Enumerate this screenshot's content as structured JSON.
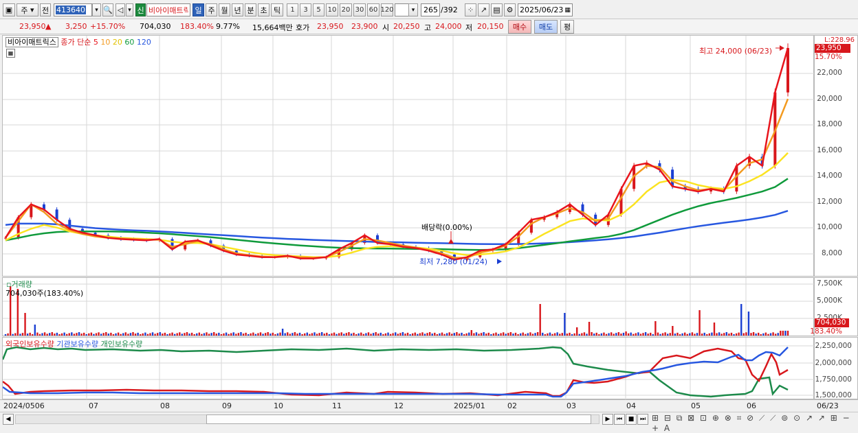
{
  "toolbar": {
    "market_type": "주",
    "prev_label": "전",
    "code": "413640",
    "name_badge": "신",
    "stock_name": "비아이매트릭스",
    "periods": [
      "일",
      "주",
      "월",
      "년",
      "분",
      "초",
      "틱"
    ],
    "numbers": [
      "1",
      "3",
      "5",
      "10",
      "20",
      "30",
      "60",
      "120"
    ],
    "count": "265",
    "count_total": "/392",
    "date": "2025/06/23"
  },
  "info": {
    "price": "23,950",
    "change_sym": "▲",
    "change": "3,250",
    "change_pct": "+15.70%",
    "volume": "704,030",
    "volume_pct": "183.40%",
    "turnover_ratio": "9.77%",
    "amount": "15,664백만",
    "ask_label": "호가",
    "ask": "23,950",
    "bid": "23,900",
    "open_label": "시",
    "open": "20,250",
    "high_label": "고",
    "high": "24,000",
    "low_label": "저",
    "low": "20,150",
    "buy_button": "매수",
    "sell_button": "매도",
    "eval_button": "평"
  },
  "price_panel": {
    "legend_name": "비아이매트릭스",
    "legend_title": "종가 단순",
    "ma_periods": [
      "5",
      "10",
      "20",
      "60",
      "120"
    ],
    "ma_colors": [
      "#e8141c",
      "#f39a1f",
      "#fbe321",
      "#0f9a3b",
      "#2757e0"
    ],
    "max_label": "최고 24,000 (06/23)",
    "min_label": "최저 7,280 (01/24)",
    "dividend_label": "배당락(0.00%)",
    "axis_top": "L:228.96",
    "axis_price": "23,950",
    "axis_pct": "15.70%",
    "yticks": [
      "22,000",
      "20,000",
      "18,000",
      "16,000",
      "14,000",
      "12,000",
      "10,000",
      "8,000"
    ]
  },
  "volume_panel": {
    "title": "거래량",
    "value_label": "704,030주(183.40%)",
    "yticks": [
      "7,500K",
      "5,000K",
      "2,500K"
    ],
    "axis_value": "704,030",
    "axis_pct": "183.40%"
  },
  "holdings_panel": {
    "legend": [
      "외국인보유수량",
      "기관보유수량",
      "개인보유수량"
    ],
    "yticks": [
      "2,250,000",
      "2,000,000",
      "1,750,000",
      "1,500,000"
    ]
  },
  "dates": [
    "2024/0506",
    "07",
    "08",
    "09",
    "10",
    "11",
    "12",
    "2025/01",
    "02",
    "03",
    "04",
    "05",
    "06",
    "06/23"
  ],
  "chart_data": {
    "type": "candlestick",
    "price": {
      "ylim": [
        7000,
        24300
      ],
      "max": {
        "value": 24000,
        "date": "06/23"
      },
      "min": {
        "value": 7280,
        "date": "01/24"
      },
      "last": 23950,
      "close": [
        9200,
        10800,
        11800,
        11400,
        10600,
        9900,
        9600,
        9400,
        9200,
        9100,
        9050,
        9000,
        9100,
        8300,
        8900,
        9000,
        8600,
        8200,
        7900,
        7800,
        7700,
        7700,
        7800,
        7600,
        7600,
        7700,
        8300,
        8800,
        9400,
        8800,
        8700,
        8500,
        8400,
        8200,
        7900,
        7500,
        7700,
        8200,
        8300,
        8700,
        9600,
        10600,
        10800,
        11200,
        11800,
        11000,
        10200,
        11000,
        13000,
        14800,
        15000,
        14500,
        13200,
        13000,
        12800,
        13000,
        12800,
        14800,
        15500,
        14800,
        20500,
        23950
      ],
      "ma5": [
        9200,
        10500,
        11800,
        11200,
        10300,
        9800,
        9500,
        9300,
        9200,
        9150,
        9100,
        9050,
        9050,
        8500,
        8700,
        8950,
        8700,
        8300,
        8000,
        7850,
        7750,
        7700,
        7750,
        7700,
        7650,
        7700,
        8100,
        8600,
        9100,
        9000,
        8800,
        8600,
        8450,
        8250,
        8000,
        7650,
        7650,
        8050,
        8250,
        8600,
        9300,
        10300,
        10800,
        11100,
        11500,
        11200,
        10500,
        10700,
        12300,
        14000,
        14800,
        14700,
        13600,
        13200,
        12900,
        13000,
        12900,
        14000,
        15000,
        15300,
        17500,
        20000
      ],
      "ma20": [
        9000,
        9500,
        9900,
        10200,
        10000,
        9700,
        9500,
        9400,
        9300,
        9200,
        9150,
        9100,
        9050,
        8900,
        8800,
        8800,
        8700,
        8500,
        8300,
        8100,
        7950,
        7850,
        7800,
        7750,
        7700,
        7700,
        7800,
        8050,
        8350,
        8500,
        8550,
        8500,
        8450,
        8350,
        8200,
        8000,
        7850,
        7900,
        8000,
        8150,
        8450,
        8950,
        9500,
        10000,
        10500,
        10700,
        10600,
        10550,
        11000,
        11800,
        12800,
        13500,
        13700,
        13600,
        13300,
        13100,
        13000,
        13200,
        13600,
        14100,
        14800,
        15800
      ],
      "ma60": [
        9000,
        9200,
        9400,
        9550,
        9650,
        9700,
        9700,
        9700,
        9700,
        9680,
        9650,
        9600,
        9550,
        9480,
        9400,
        9330,
        9250,
        9150,
        9050,
        8950,
        8850,
        8760,
        8680,
        8600,
        8540,
        8480,
        8430,
        8400,
        8380,
        8370,
        8360,
        8350,
        8340,
        8330,
        8320,
        8290,
        8270,
        8260,
        8270,
        8310,
        8400,
        8520,
        8650,
        8780,
        8920,
        9050,
        9180,
        9300,
        9500,
        9800,
        10200,
        10600,
        11000,
        11350,
        11650,
        11900,
        12100,
        12300,
        12550,
        12800,
        13150,
        13800
      ],
      "ma120": [
        10200,
        10300,
        10300,
        10300,
        10250,
        10150,
        10050,
        9950,
        9880,
        9820,
        9780,
        9740,
        9700,
        9640,
        9580,
        9520,
        9460,
        9400,
        9340,
        9280,
        9220,
        9170,
        9120,
        9080,
        9040,
        9000,
        8970,
        8940,
        8910,
        8880,
        8860,
        8840,
        8820,
        8800,
        8780,
        8760,
        8740,
        8720,
        8710,
        8710,
        8720,
        8740,
        8770,
        8810,
        8860,
        8930,
        9000,
        9080,
        9180,
        9300,
        9450,
        9600,
        9770,
        9940,
        10100,
        10240,
        10370,
        10490,
        10620,
        10780,
        10980,
        11300
      ]
    },
    "volume": {
      "ylim": [
        0,
        8000000
      ],
      "last": 704030
    },
    "holdings": {
      "ylim": [
        1430000,
        2300000
      ],
      "series": [
        {
          "name": "외국인보유수량",
          "color": "#d8171c"
        },
        {
          "name": "기관보유수량",
          "color": "#2757e0"
        },
        {
          "name": "개인보유수량",
          "color": "#1c8a4a"
        }
      ]
    }
  }
}
